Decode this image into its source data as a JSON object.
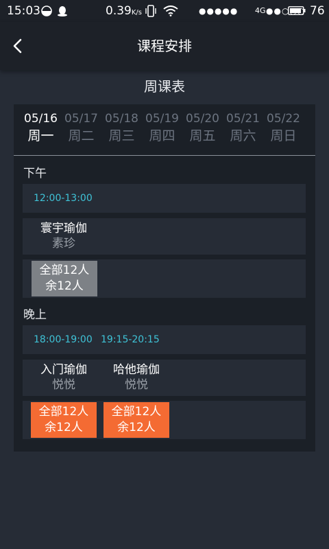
{
  "status_bar": {
    "time": "15:03",
    "speed": "0.39",
    "speed_unit": "K/s",
    "signal_dots": "●●●●●",
    "network": "4G",
    "signal_dots2": "●●○○○",
    "battery": "76"
  },
  "header": {
    "title": "课程安排"
  },
  "week_title": "周课表",
  "days": [
    {
      "date": "05/16",
      "weekday": "周一",
      "active": true
    },
    {
      "date": "05/17",
      "weekday": "周二",
      "active": false
    },
    {
      "date": "05/18",
      "weekday": "周三",
      "active": false
    },
    {
      "date": "05/19",
      "weekday": "周四",
      "active": false
    },
    {
      "date": "05/20",
      "weekday": "周五",
      "active": false
    },
    {
      "date": "05/21",
      "weekday": "周六",
      "active": false
    },
    {
      "date": "05/22",
      "weekday": "周日",
      "active": false
    }
  ],
  "afternoon": {
    "label": "下午",
    "times": [
      "12:00-13:00"
    ],
    "courses": [
      {
        "name": "寰宇瑜伽",
        "teacher": "素珍"
      }
    ],
    "slots": [
      {
        "total": "全部12人",
        "remaining": "余12人",
        "color": "#7d8186"
      }
    ]
  },
  "evening": {
    "label": "晚上",
    "times": [
      "18:00-19:00",
      "19:15-20:15"
    ],
    "courses": [
      {
        "name": "入门瑜伽",
        "teacher": "悦悦"
      },
      {
        "name": "哈他瑜伽",
        "teacher": "悦悦"
      }
    ],
    "slots": [
      {
        "total": "全部12人",
        "remaining": "余12人",
        "color": "#f46b33"
      },
      {
        "total": "全部12人",
        "remaining": "余12人",
        "color": "#f46b33"
      }
    ]
  }
}
